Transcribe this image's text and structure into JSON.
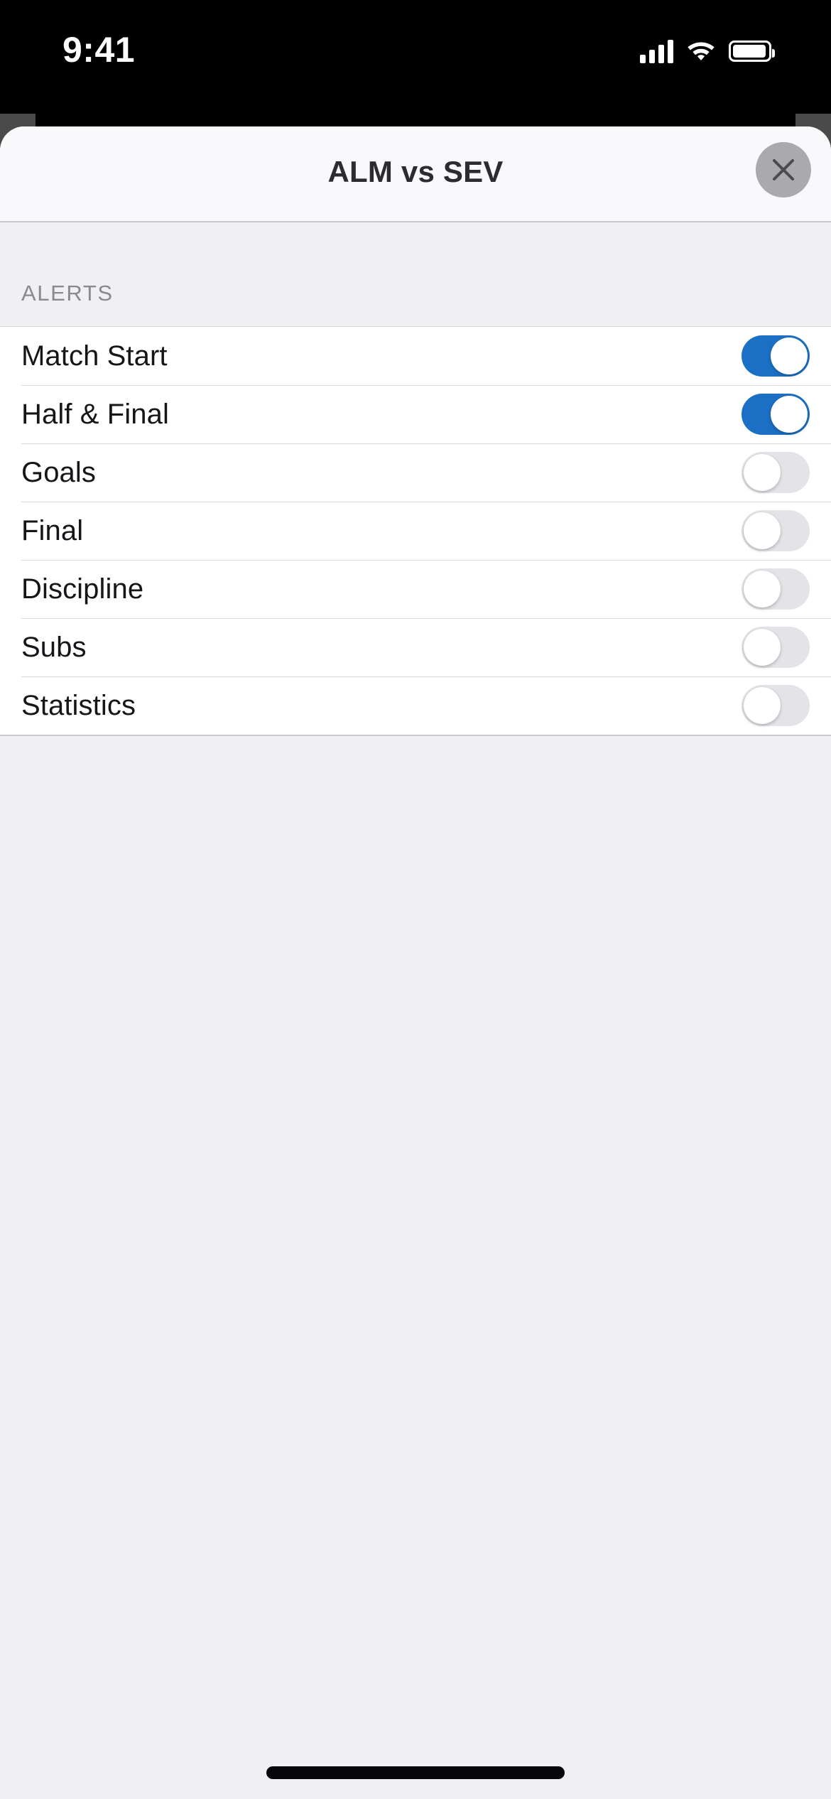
{
  "status_bar": {
    "time": "9:41",
    "cellular_icon": "cellular-bars-icon",
    "wifi_icon": "wifi-icon",
    "battery_icon": "battery-icon"
  },
  "navbar": {
    "title": "ALM vs SEV",
    "close_icon": "close-x-icon"
  },
  "section": {
    "header": "ALERTS"
  },
  "alerts": {
    "rows": [
      {
        "label": "Match Start",
        "state": "on"
      },
      {
        "label": "Half & Final",
        "state": "on"
      },
      {
        "label": "Goals",
        "state": "off"
      },
      {
        "label": "Final",
        "state": "off"
      },
      {
        "label": "Discipline",
        "state": "off"
      },
      {
        "label": "Subs",
        "state": "off"
      },
      {
        "label": "Statistics",
        "state": "off"
      }
    ]
  },
  "colors": {
    "toggle_on": "#1b6fc4",
    "toggle_off_track": "#e3e3e8",
    "knob": "#ffffff",
    "sheet_background": "#f0f0f2",
    "navbar_background": "#f9f8fb",
    "list_background": "#ffffff",
    "label_text": "#16161a",
    "section_header_text": "#8a8a8e",
    "title_text": "#2c2c30",
    "close_button_background": "#a9a9ae",
    "backdrop": "#4a4a4a"
  },
  "home_indicator": "home-indicator"
}
